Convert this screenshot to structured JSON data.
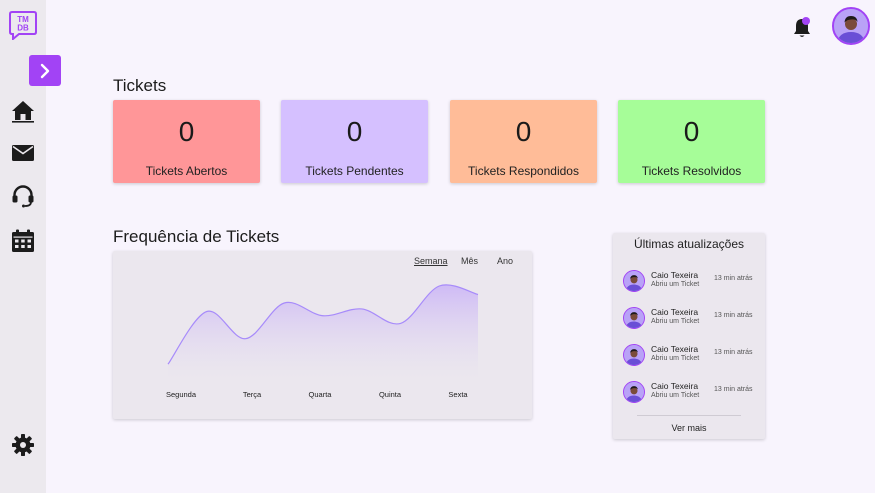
{
  "logo": {
    "line1": "TM",
    "line2": "DB"
  },
  "sidebar": {
    "items": [
      {
        "name": "home",
        "icon": "home-icon"
      },
      {
        "name": "mail",
        "icon": "mail-icon"
      },
      {
        "name": "support",
        "icon": "headset-icon"
      },
      {
        "name": "calendar",
        "icon": "calendar-icon"
      }
    ],
    "settings_icon": "gear-icon"
  },
  "tickets": {
    "title": "Tickets",
    "cards": [
      {
        "value": "0",
        "label": "Tickets Abertos",
        "color": "#ff9698"
      },
      {
        "value": "0",
        "label": "Tickets Pendentes",
        "color": "#d5c0ff"
      },
      {
        "value": "0",
        "label": "Tickets Respondidos",
        "color": "#ffbc98"
      },
      {
        "value": "0",
        "label": "Tickets Resolvidos",
        "color": "#a6fd98"
      }
    ]
  },
  "frequency": {
    "title": "Frequência de Tickets",
    "periods": [
      "Semana",
      "Mês",
      "Ano"
    ],
    "active_period": "Semana"
  },
  "chart_data": {
    "type": "area",
    "categories": [
      "Segunda",
      "Terça",
      "Quarta",
      "Quinta",
      "Sexta"
    ],
    "x_positions": [
      0,
      0.19,
      0.39,
      0.58,
      0.78,
      0.9,
      1.0
    ],
    "series": [
      {
        "values": [
          0.08,
          0.7,
          0.38,
          0.8,
          0.65,
          0.73,
          0.56,
          1.0,
          0.9
        ]
      }
    ],
    "color": "#a78bfa",
    "fill_color": "#d8c9f5"
  },
  "updates": {
    "title": "Últimas atualizações",
    "items": [
      {
        "name": "Caio Texeira",
        "action": "Abriu um Ticket",
        "time": "13 min atrás"
      },
      {
        "name": "Caio Texeira",
        "action": "Abriu um Ticket",
        "time": "13 min atrás"
      },
      {
        "name": "Caio Texeira",
        "action": "Abriu um Ticket",
        "time": "13 min atrás"
      },
      {
        "name": "Caio Texeira",
        "action": "Abriu um Ticket",
        "time": "13 min atrás"
      }
    ],
    "more_label": "Ver mais"
  },
  "colors": {
    "accent": "#a243f5",
    "sidebar": "#ece9ee",
    "background": "#f8f4fd"
  }
}
